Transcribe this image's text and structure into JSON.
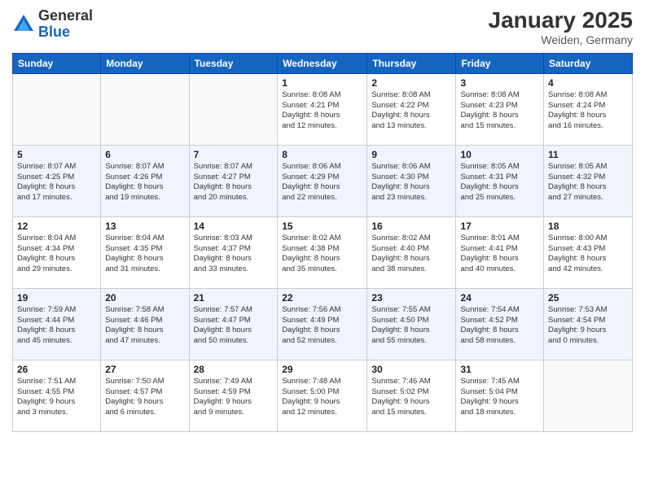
{
  "header": {
    "logo_general": "General",
    "logo_blue": "Blue",
    "month": "January 2025",
    "location": "Weiden, Germany"
  },
  "weekdays": [
    "Sunday",
    "Monday",
    "Tuesday",
    "Wednesday",
    "Thursday",
    "Friday",
    "Saturday"
  ],
  "weeks": [
    [
      {
        "day": "",
        "info": ""
      },
      {
        "day": "",
        "info": ""
      },
      {
        "day": "",
        "info": ""
      },
      {
        "day": "1",
        "info": "Sunrise: 8:08 AM\nSunset: 4:21 PM\nDaylight: 8 hours\nand 12 minutes."
      },
      {
        "day": "2",
        "info": "Sunrise: 8:08 AM\nSunset: 4:22 PM\nDaylight: 8 hours\nand 13 minutes."
      },
      {
        "day": "3",
        "info": "Sunrise: 8:08 AM\nSunset: 4:23 PM\nDaylight: 8 hours\nand 15 minutes."
      },
      {
        "day": "4",
        "info": "Sunrise: 8:08 AM\nSunset: 4:24 PM\nDaylight: 8 hours\nand 16 minutes."
      }
    ],
    [
      {
        "day": "5",
        "info": "Sunrise: 8:07 AM\nSunset: 4:25 PM\nDaylight: 8 hours\nand 17 minutes."
      },
      {
        "day": "6",
        "info": "Sunrise: 8:07 AM\nSunset: 4:26 PM\nDaylight: 8 hours\nand 19 minutes."
      },
      {
        "day": "7",
        "info": "Sunrise: 8:07 AM\nSunset: 4:27 PM\nDaylight: 8 hours\nand 20 minutes."
      },
      {
        "day": "8",
        "info": "Sunrise: 8:06 AM\nSunset: 4:29 PM\nDaylight: 8 hours\nand 22 minutes."
      },
      {
        "day": "9",
        "info": "Sunrise: 8:06 AM\nSunset: 4:30 PM\nDaylight: 8 hours\nand 23 minutes."
      },
      {
        "day": "10",
        "info": "Sunrise: 8:05 AM\nSunset: 4:31 PM\nDaylight: 8 hours\nand 25 minutes."
      },
      {
        "day": "11",
        "info": "Sunrise: 8:05 AM\nSunset: 4:32 PM\nDaylight: 8 hours\nand 27 minutes."
      }
    ],
    [
      {
        "day": "12",
        "info": "Sunrise: 8:04 AM\nSunset: 4:34 PM\nDaylight: 8 hours\nand 29 minutes."
      },
      {
        "day": "13",
        "info": "Sunrise: 8:04 AM\nSunset: 4:35 PM\nDaylight: 8 hours\nand 31 minutes."
      },
      {
        "day": "14",
        "info": "Sunrise: 8:03 AM\nSunset: 4:37 PM\nDaylight: 8 hours\nand 33 minutes."
      },
      {
        "day": "15",
        "info": "Sunrise: 8:02 AM\nSunset: 4:38 PM\nDaylight: 8 hours\nand 35 minutes."
      },
      {
        "day": "16",
        "info": "Sunrise: 8:02 AM\nSunset: 4:40 PM\nDaylight: 8 hours\nand 38 minutes."
      },
      {
        "day": "17",
        "info": "Sunrise: 8:01 AM\nSunset: 4:41 PM\nDaylight: 8 hours\nand 40 minutes."
      },
      {
        "day": "18",
        "info": "Sunrise: 8:00 AM\nSunset: 4:43 PM\nDaylight: 8 hours\nand 42 minutes."
      }
    ],
    [
      {
        "day": "19",
        "info": "Sunrise: 7:59 AM\nSunset: 4:44 PM\nDaylight: 8 hours\nand 45 minutes."
      },
      {
        "day": "20",
        "info": "Sunrise: 7:58 AM\nSunset: 4:46 PM\nDaylight: 8 hours\nand 47 minutes."
      },
      {
        "day": "21",
        "info": "Sunrise: 7:57 AM\nSunset: 4:47 PM\nDaylight: 8 hours\nand 50 minutes."
      },
      {
        "day": "22",
        "info": "Sunrise: 7:56 AM\nSunset: 4:49 PM\nDaylight: 8 hours\nand 52 minutes."
      },
      {
        "day": "23",
        "info": "Sunrise: 7:55 AM\nSunset: 4:50 PM\nDaylight: 8 hours\nand 55 minutes."
      },
      {
        "day": "24",
        "info": "Sunrise: 7:54 AM\nSunset: 4:52 PM\nDaylight: 8 hours\nand 58 minutes."
      },
      {
        "day": "25",
        "info": "Sunrise: 7:53 AM\nSunset: 4:54 PM\nDaylight: 9 hours\nand 0 minutes."
      }
    ],
    [
      {
        "day": "26",
        "info": "Sunrise: 7:51 AM\nSunset: 4:55 PM\nDaylight: 9 hours\nand 3 minutes."
      },
      {
        "day": "27",
        "info": "Sunrise: 7:50 AM\nSunset: 4:57 PM\nDaylight: 9 hours\nand 6 minutes."
      },
      {
        "day": "28",
        "info": "Sunrise: 7:49 AM\nSunset: 4:59 PM\nDaylight: 9 hours\nand 9 minutes."
      },
      {
        "day": "29",
        "info": "Sunrise: 7:48 AM\nSunset: 5:00 PM\nDaylight: 9 hours\nand 12 minutes."
      },
      {
        "day": "30",
        "info": "Sunrise: 7:46 AM\nSunset: 5:02 PM\nDaylight: 9 hours\nand 15 minutes."
      },
      {
        "day": "31",
        "info": "Sunrise: 7:45 AM\nSunset: 5:04 PM\nDaylight: 9 hours\nand 18 minutes."
      },
      {
        "day": "",
        "info": ""
      }
    ]
  ]
}
